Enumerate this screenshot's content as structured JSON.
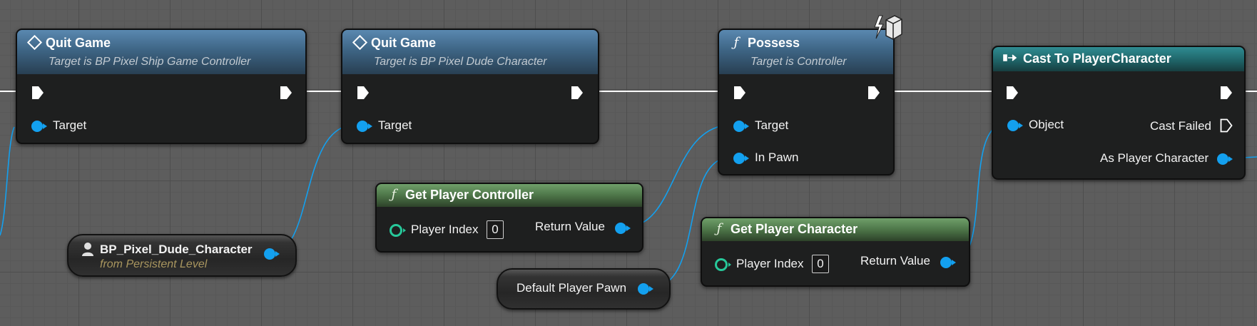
{
  "nodes": {
    "quit_game_1": {
      "title": "Quit Game",
      "subtitle": "Target is BP Pixel Ship Game Controller",
      "pins": {
        "target": "Target"
      }
    },
    "quit_game_2": {
      "title": "Quit Game",
      "subtitle": "Target is BP Pixel Dude Character",
      "pins": {
        "target": "Target"
      }
    },
    "possess": {
      "title": "Possess",
      "subtitle": "Target is Controller",
      "pins": {
        "target": "Target",
        "in_pawn": "In Pawn"
      }
    },
    "cast_to_player_character": {
      "title": "Cast To PlayerCharacter",
      "pins": {
        "object": "Object",
        "cast_failed": "Cast Failed",
        "as_player_character": "As Player Character"
      }
    },
    "get_player_controller": {
      "title": "Get Player Controller",
      "pins": {
        "player_index": "Player Index",
        "player_index_value": "0",
        "return_value": "Return Value"
      }
    },
    "get_player_character": {
      "title": "Get Player Character",
      "pins": {
        "player_index": "Player Index",
        "player_index_value": "0",
        "return_value": "Return Value"
      }
    },
    "bp_pixel_dude_reference": {
      "title": "BP_Pixel_Dude_Character",
      "subtitle": "from Persistent Level"
    },
    "default_player_pawn": {
      "title": "Default Player Pawn"
    }
  },
  "icons": {
    "event_function": "diamond-icon",
    "function": "function-icon",
    "cast": "cast-icon",
    "actor_reference": "person-icon",
    "network": "replication-cube-icon"
  },
  "colors": {
    "canvas": "#5d5d5d",
    "object_pin": "#13a0ef",
    "int_pin": "#27c89a",
    "exec_wire": "#ffffff",
    "function_header": "#3e6585",
    "pure_function_header": "#4d7548",
    "cast_header": "#1f6468",
    "reference_subtitle": "#a9965f"
  }
}
